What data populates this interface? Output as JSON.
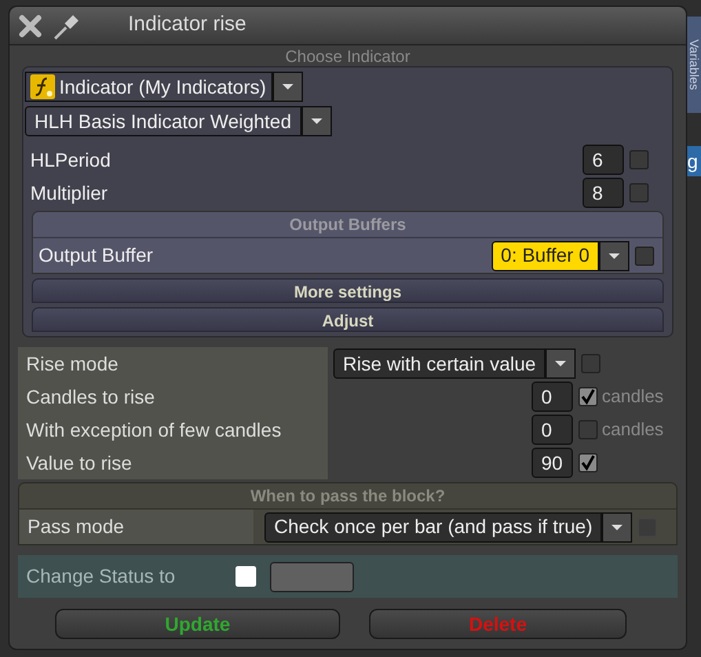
{
  "window": {
    "title": "Indicator rise"
  },
  "side_tab": {
    "label": "Variables"
  },
  "side_fragment": "g",
  "indicator_panel": {
    "title": "Choose Indicator",
    "source": "Indicator (My Indicators)",
    "indicator": "HLH Basis Indicator Weighted",
    "params": [
      {
        "label": "HLPeriod",
        "value": "6",
        "checked": false
      },
      {
        "label": "Multiplier",
        "value": "8",
        "checked": false
      }
    ],
    "output_section": {
      "title": "Output Buffers",
      "label": "Output Buffer",
      "value": "0: Buffer 0",
      "checked": false
    },
    "sections": [
      "More settings",
      "Adjust"
    ]
  },
  "settings": [
    {
      "kind": "dropdown",
      "label": "Rise mode",
      "value": "Rise with certain value",
      "checked": false
    },
    {
      "kind": "number",
      "label": "Candles to rise",
      "value": "0",
      "checked": true,
      "unit": "candles"
    },
    {
      "kind": "number",
      "label": "With exception of few candles",
      "value": "0",
      "checked": false,
      "unit": "candles"
    },
    {
      "kind": "number",
      "label": "Value to rise",
      "value": "90",
      "checked": true
    }
  ],
  "pass_section": {
    "title": "When to pass the block?",
    "label": "Pass mode",
    "value": "Check once per bar (and pass if true)",
    "disabled": true
  },
  "status": {
    "label": "Change Status to",
    "checked": false
  },
  "buttons": [
    {
      "label": "Update",
      "kind": "confirm"
    },
    {
      "label": "Delete",
      "kind": "danger"
    }
  ]
}
